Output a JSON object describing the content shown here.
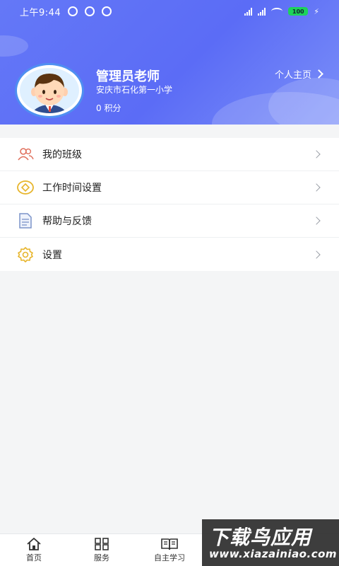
{
  "status_bar": {
    "time": "上午9:44",
    "battery": "100"
  },
  "profile": {
    "name": "管理员老师",
    "school": "安庆市石化第一小学",
    "points": "0 积分",
    "homepage_link": "个人主页"
  },
  "menu": [
    {
      "label": "我的班级",
      "icon": "users-icon"
    },
    {
      "label": "工作时间设置",
      "icon": "coin-icon"
    },
    {
      "label": "帮助与反馈",
      "icon": "document-icon"
    },
    {
      "label": "设置",
      "icon": "gear-icon"
    }
  ],
  "bottom_nav": [
    {
      "label": "首页",
      "icon": "home-icon"
    },
    {
      "label": "服务",
      "icon": "grid-icon"
    },
    {
      "label": "自主学习",
      "icon": "book-icon"
    }
  ],
  "watermark": {
    "title": "下载鸟应用",
    "url": "www.xiazainiao.com"
  },
  "colors": {
    "header": "#5b6cf6",
    "accent": "#f0b429"
  }
}
